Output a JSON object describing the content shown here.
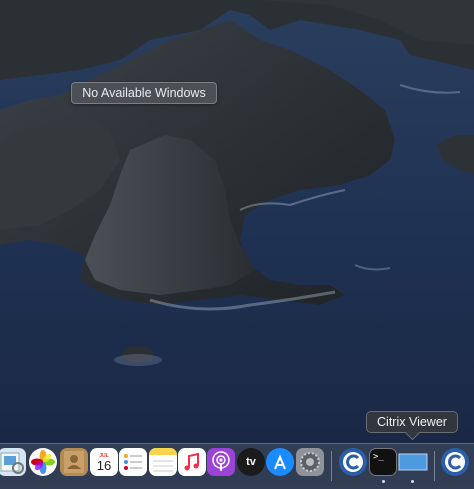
{
  "desktop": {
    "no_windows_label": "No Available Windows"
  },
  "dock": {
    "tooltip_label": "Citrix Viewer",
    "items": [
      {
        "icon": "preview-icon"
      },
      {
        "icon": "photos-icon"
      },
      {
        "icon": "contacts-icon"
      },
      {
        "icon": "calendar-icon",
        "day": "16",
        "month": "JUL"
      },
      {
        "icon": "reminders-icon"
      },
      {
        "icon": "notes-icon"
      },
      {
        "icon": "music-icon"
      },
      {
        "icon": "podcasts-icon"
      },
      {
        "icon": "apple-tv-icon",
        "label": "tv"
      },
      {
        "icon": "app-store-icon"
      },
      {
        "icon": "system-preferences-icon"
      },
      {
        "icon": "citrix-workspace-icon"
      },
      {
        "icon": "terminal-icon",
        "label": ">_"
      },
      {
        "icon": "citrix-viewer-icon"
      },
      {
        "icon": "citrix-workspace-icon"
      }
    ]
  }
}
